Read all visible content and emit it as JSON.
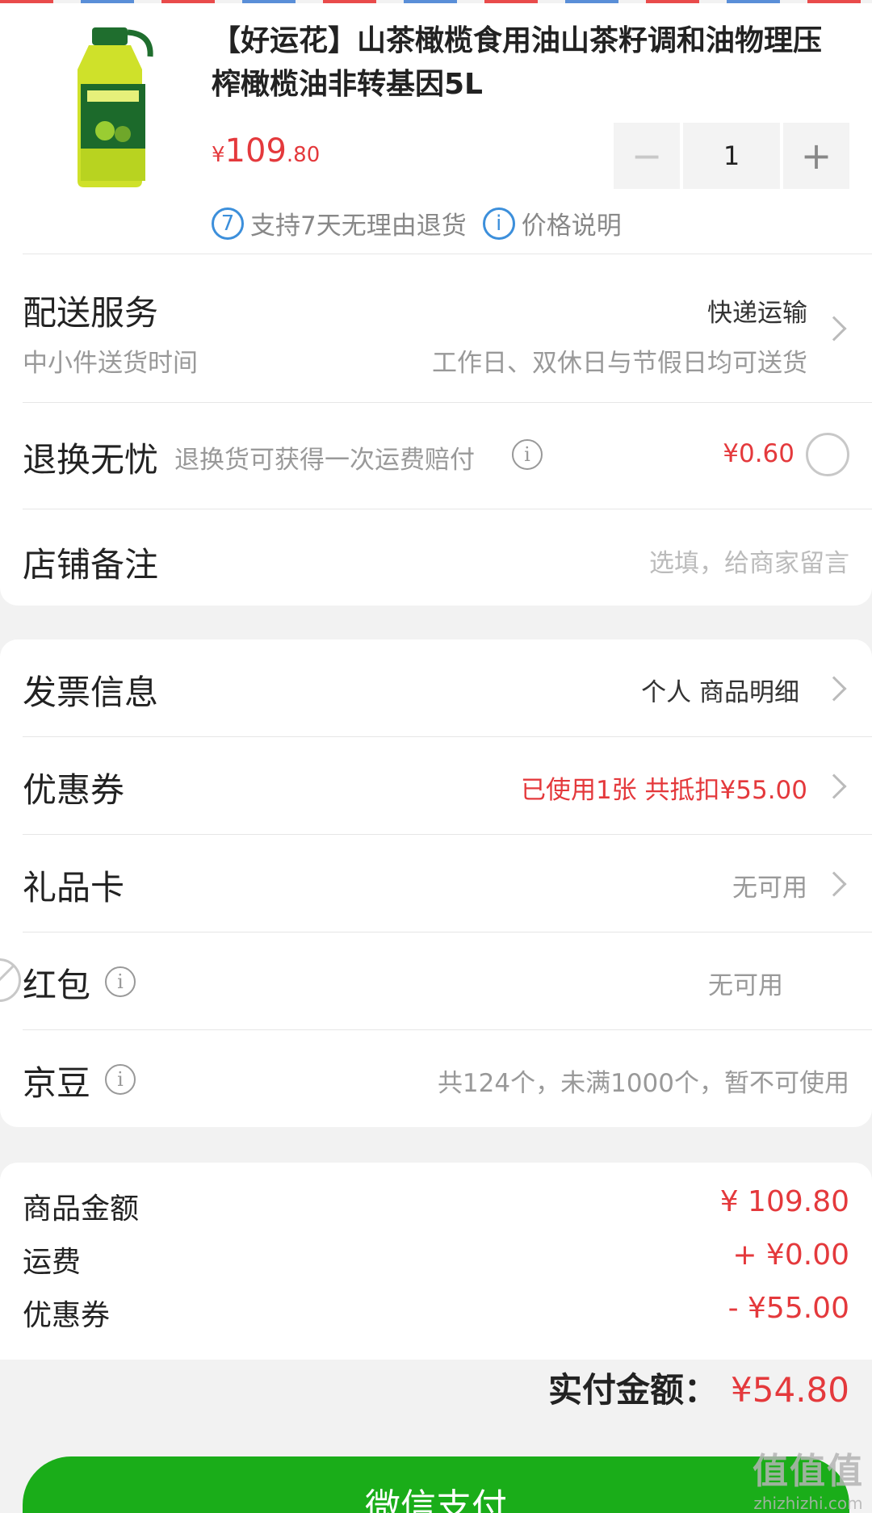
{
  "product": {
    "title": "【好运花】山茶橄榄食用油山茶籽调和油物理压榨橄榄油非转基因5L",
    "price_currency": "¥",
    "price_int": "109",
    "price_dec": ".80",
    "quantity": "1",
    "minus_label": "−",
    "plus_label": "+",
    "badges": [
      {
        "icon_text": "7",
        "label": "支持7天无理由退货"
      },
      {
        "icon_text": "i",
        "label": "价格说明"
      }
    ],
    "image_icon": "oil-bottle-icon"
  },
  "delivery": {
    "title": "配送服务",
    "value": "快递运输",
    "sub_left": "中小件送货时间",
    "sub_right": "工作日、双休日与节假日均可送货"
  },
  "return_guarantee": {
    "title": "退换无忧",
    "desc": "退换货可获得一次运费赔付",
    "price": "¥0.60"
  },
  "store_note": {
    "title": "店铺备注",
    "placeholder": "选填，给商家留言"
  },
  "invoice": {
    "title": "发票信息",
    "value": "个人 商品明细"
  },
  "coupon": {
    "title": "优惠券",
    "value": "已使用1张 共抵扣¥55.00"
  },
  "gift_card": {
    "title": "礼品卡",
    "value": "无可用"
  },
  "red_packet": {
    "title": "红包",
    "value": "无可用"
  },
  "jingdou": {
    "title": "京豆",
    "value": "共124个，未满1000个，暂不可使用"
  },
  "summary": {
    "rows": [
      {
        "label": "商品金额",
        "value": "¥ 109.80"
      },
      {
        "label": "运费",
        "value": "+ ¥0.00"
      },
      {
        "label": "优惠券",
        "value": "- ¥55.00"
      }
    ],
    "total_label": "实付金额：",
    "total_value": "¥54.80"
  },
  "pay_button": "微信支付",
  "watermark": {
    "main": "值值值",
    "sub": "zhizhizhi.com"
  },
  "colors": {
    "accent_red": "#e4393c",
    "pay_green": "#1aad19",
    "badge_blue": "#3c8fdb"
  }
}
